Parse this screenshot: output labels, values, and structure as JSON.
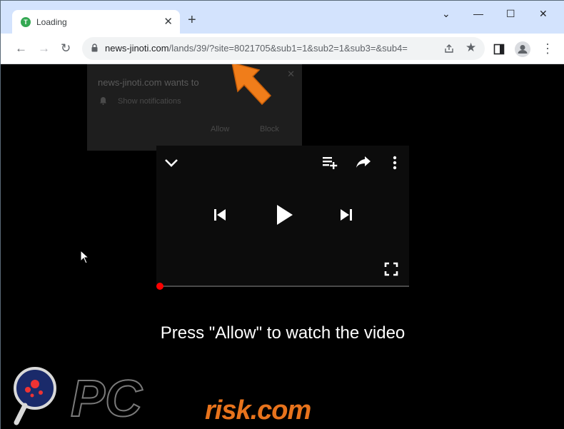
{
  "tab": {
    "favicon_letter": "T",
    "title": "Loading",
    "close": "✕"
  },
  "window_controls": {
    "new_tab": "+",
    "chevron": "⌄",
    "minimize": "—",
    "maximize": "☐",
    "close": "✕"
  },
  "toolbar": {
    "back": "←",
    "forward": "→",
    "reload": "↻",
    "url_host": "news-jinoti.com",
    "url_path": "/lands/39/?site=8021705&sub1=1&sub2=1&sub3=&sub4=",
    "share_icon": "share-icon",
    "bookmark_icon": "★",
    "sidepanel_icon": "sidepanel-icon",
    "menu": "⋮"
  },
  "notification_prompt": {
    "title": "news-jinoti.com wants to",
    "permission": "Show notifications",
    "allow": "Allow",
    "block": "Block",
    "close": "✕"
  },
  "player": {
    "collapse_icon": "chevron-down-icon",
    "queue_icon": "playlist-add-icon",
    "share_icon": "share-arrow-icon",
    "more_icon": "more-vert-icon",
    "prev_icon": "skip-previous-icon",
    "play_icon": "play-icon",
    "next_icon": "skip-next-icon",
    "fullscreen_icon": "fullscreen-icon",
    "progress": 0
  },
  "caption": "Press \"Allow\" to watch the video",
  "watermark": {
    "pc": "PC",
    "text": "risk.com"
  },
  "colors": {
    "accent_arrow": "#f07d1a",
    "progress_dot": "#ff0000",
    "tab_bar": "#d3e3fd"
  }
}
